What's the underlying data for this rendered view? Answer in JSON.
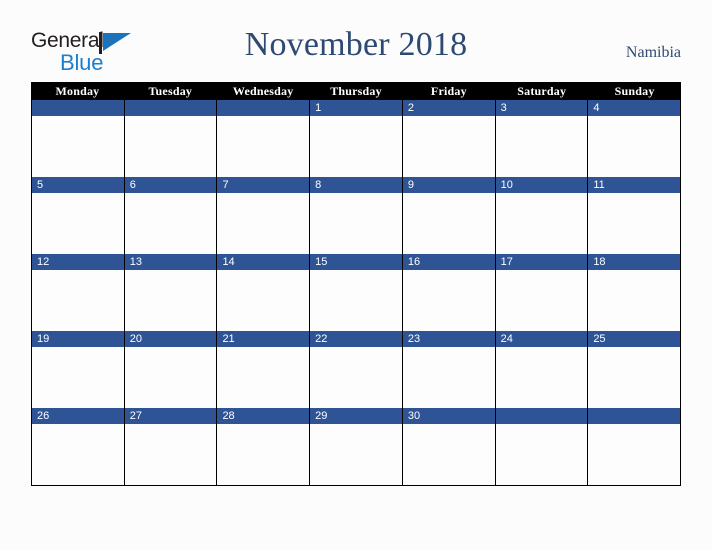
{
  "brand": {
    "name_part1": "General",
    "name_part2": "Blue",
    "mark_icon": "blue-flag-triangle-icon",
    "blue_hex": "#1b7fd0",
    "dark_hex": "#231f20"
  },
  "header": {
    "title": "November 2018",
    "country": "Namibia",
    "title_color": "#2e4a72"
  },
  "calendar": {
    "month": "November",
    "year": "2018",
    "accent_hex": "#2e5496",
    "header_bg_hex": "#000000",
    "weekdays": [
      "Monday",
      "Tuesday",
      "Wednesday",
      "Thursday",
      "Friday",
      "Saturday",
      "Sunday"
    ],
    "weeks": [
      [
        "",
        "",
        "",
        "1",
        "2",
        "3",
        "4"
      ],
      [
        "5",
        "6",
        "7",
        "8",
        "9",
        "10",
        "11"
      ],
      [
        "12",
        "13",
        "14",
        "15",
        "16",
        "17",
        "18"
      ],
      [
        "19",
        "20",
        "21",
        "22",
        "23",
        "24",
        "25"
      ],
      [
        "26",
        "27",
        "28",
        "29",
        "30",
        "",
        ""
      ]
    ]
  }
}
